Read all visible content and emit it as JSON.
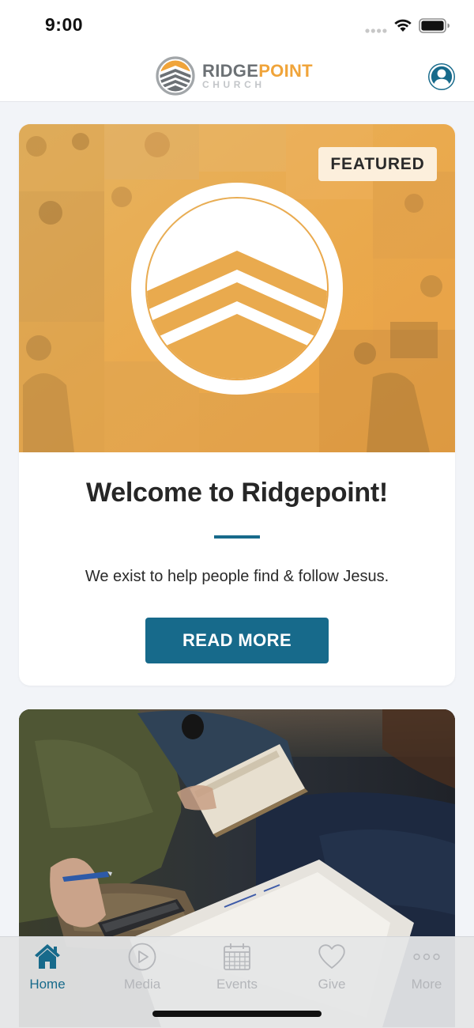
{
  "status_bar": {
    "time": "9:00"
  },
  "header": {
    "logo_name_part1": "RIDGE",
    "logo_name_part2": "POINT",
    "logo_subtitle": "CHURCH",
    "profile_icon": "person-icon"
  },
  "featured_card": {
    "badge": "FEATURED",
    "title": "Welcome to Ridgepoint!",
    "description": "We exist to help people find & follow Jesus.",
    "button_label": "READ MORE"
  },
  "tab_bar": {
    "tabs": [
      {
        "label": "Home",
        "icon": "home-icon",
        "active": true
      },
      {
        "label": "Media",
        "icon": "play-icon",
        "active": false
      },
      {
        "label": "Events",
        "icon": "calendar-icon",
        "active": false
      },
      {
        "label": "Give",
        "icon": "heart-icon",
        "active": false
      },
      {
        "label": "More",
        "icon": "more-icon",
        "active": false
      }
    ]
  },
  "colors": {
    "brand_blue": "#176a8b",
    "brand_orange": "#f0a43a",
    "featured_overlay": "#e9a743",
    "inactive_tab": "#b4b6ba"
  }
}
